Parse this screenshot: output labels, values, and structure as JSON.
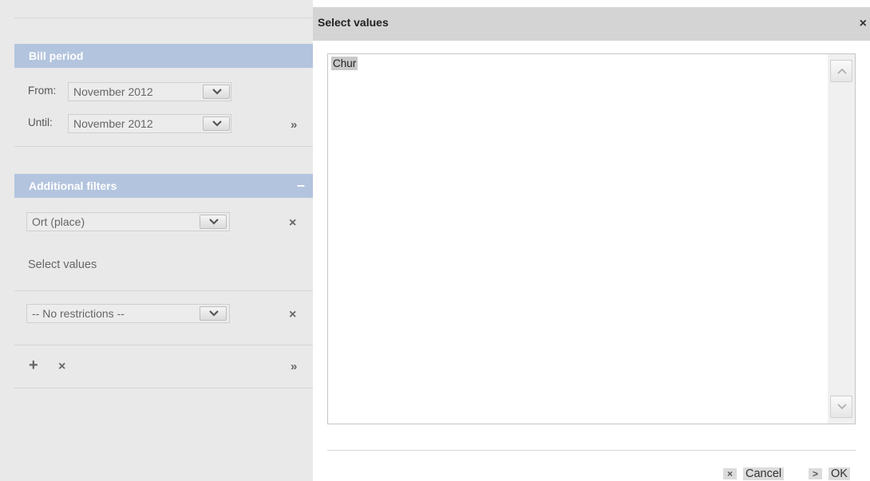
{
  "bill_period": {
    "header": "Bill period",
    "from_label": "From:",
    "from_value": "November 2012",
    "until_label": "Until:",
    "until_value": "November 2012"
  },
  "additional_filters": {
    "header": "Additional filters",
    "collapse_symbol": "–",
    "filter1_value": "Ort (place)",
    "select_values_link": "Select values",
    "filter2_value": "-- No restrictions --"
  },
  "icons": {
    "close": "×",
    "expand": "»",
    "add": "+"
  },
  "dialog": {
    "title": "Select values",
    "close_symbol": "×",
    "items": [
      "Chur"
    ],
    "cancel_label": "Cancel",
    "cancel_icon": "×",
    "ok_label": "OK",
    "ok_icon": ">"
  }
}
